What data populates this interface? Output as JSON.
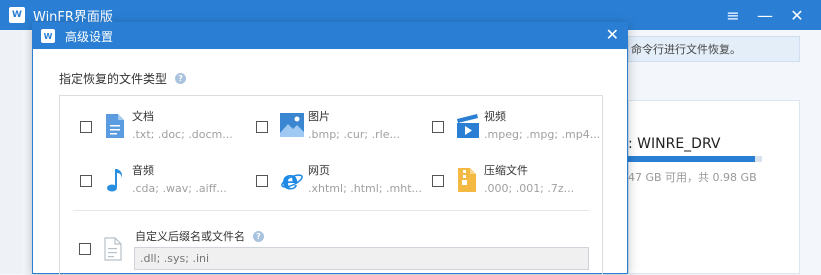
{
  "app": {
    "title": "WinFR界面版",
    "logo_text": "W",
    "controls": {
      "menu": "≡",
      "minimize": "—",
      "close": "✕"
    }
  },
  "background": {
    "info_text": "命令行进行文件恢复。",
    "drive_name": ": WINRE_DRV",
    "drive_info": "47 GB 可用，共 0.98 GB",
    "drive_usage_fraction": 0.95
  },
  "dialog": {
    "title": "高级设置",
    "close": "✕",
    "section_title": "指定恢复的文件类型",
    "help": "?",
    "types": [
      {
        "name": "文档",
        "exts": ".txt; .doc; .docm...",
        "icon": "document-icon",
        "color": "#4a8fd8"
      },
      {
        "name": "图片",
        "exts": ".bmp; .cur; .rle...",
        "icon": "picture-icon",
        "color": "#3a86d0"
      },
      {
        "name": "视频",
        "exts": ".mpeg; .mpg; .mp4...",
        "icon": "video-icon",
        "color": "#2a7fd4"
      },
      {
        "name": "音频",
        "exts": ".cda; .wav; .aiff...",
        "icon": "music-icon",
        "color": "#2a8fe0"
      },
      {
        "name": "网页",
        "exts": ".xhtml; .html; .mht...",
        "icon": "web-icon",
        "color": "#1e88e5"
      },
      {
        "name": "压缩文件",
        "exts": ".000; .001; .7z...",
        "icon": "archive-icon",
        "color": "#f4b942"
      }
    ],
    "custom": {
      "label": "自定义后缀名或文件名",
      "placeholder": ".dll; .sys; .ini"
    }
  },
  "colors": {
    "accent": "#2a7fd4"
  }
}
